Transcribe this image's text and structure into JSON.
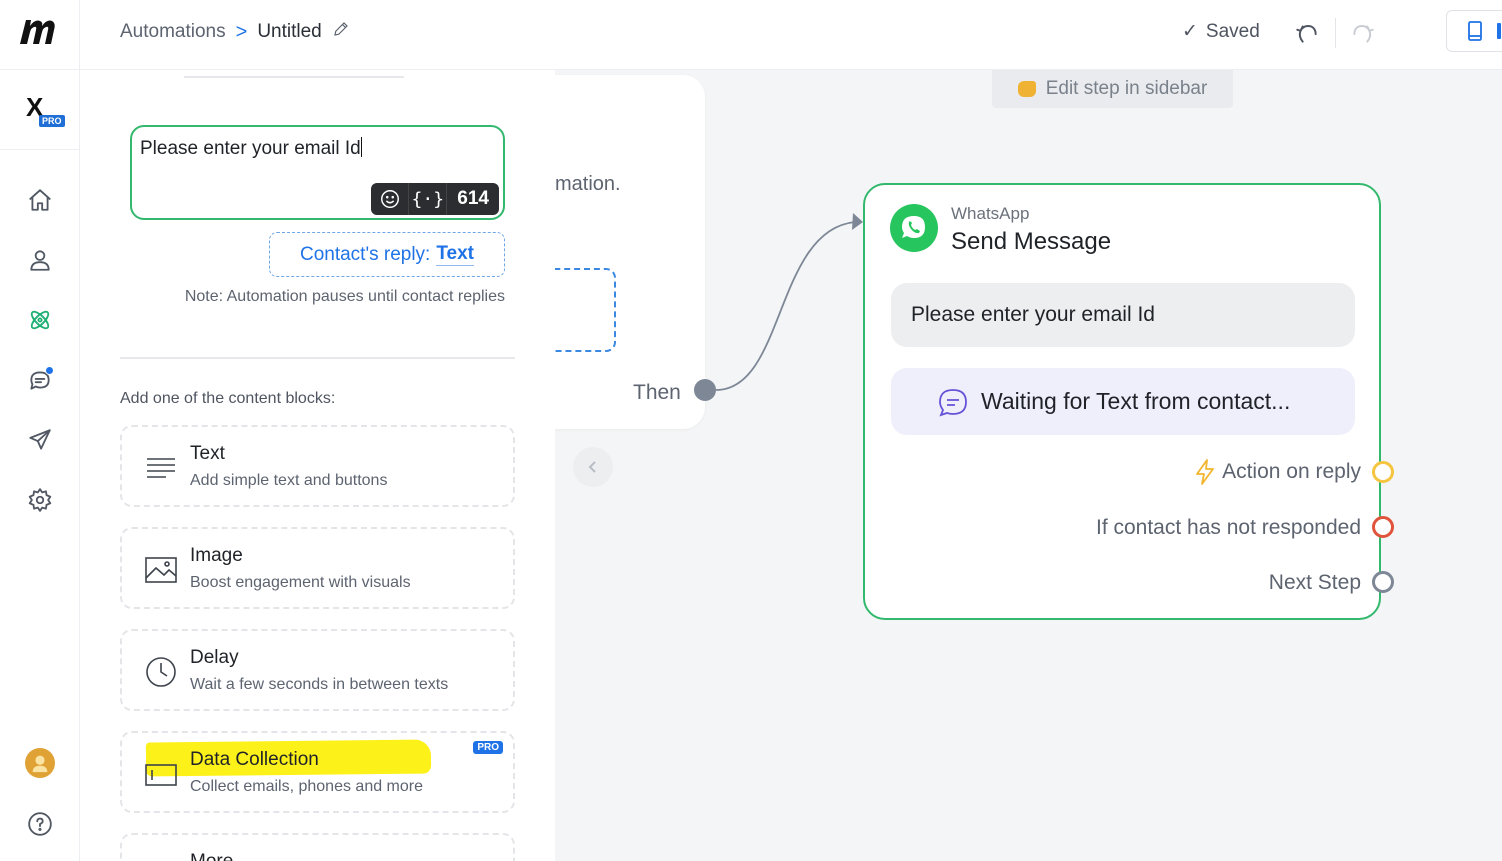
{
  "topbar": {
    "breadcrumb_root": "Automations",
    "breadcrumb_sep": ">",
    "title": "Untitled",
    "saved_check": "✓",
    "saved_label": "Saved"
  },
  "brand": {
    "badge": "PRO",
    "mark": "X"
  },
  "sidebar_nav": [
    "home-icon",
    "contacts-icon",
    "automations-icon",
    "chat-icon",
    "send-icon",
    "settings-icon",
    "help-icon"
  ],
  "editor": {
    "message_text": "Please enter your email Id",
    "tools": {
      "brace": "{·}",
      "counter": "614"
    },
    "reply_prefix": "Contact's reply:",
    "reply_type": "Text",
    "note": "Note: Automation pauses until contact replies",
    "blocks_title": "Add one of the content blocks:",
    "blocks": [
      {
        "title": "Text",
        "subtitle": "Add simple text and buttons",
        "icon": "text-lines-icon"
      },
      {
        "title": "Image",
        "subtitle": "Boost engagement with visuals",
        "icon": "image-icon"
      },
      {
        "title": "Delay",
        "subtitle": "Wait a few seconds in between texts",
        "icon": "clock-icon"
      },
      {
        "title": "Data Collection",
        "subtitle": "Collect emails, phones and more",
        "badge": "PRO",
        "icon": "input-field-icon"
      },
      {
        "title": "More",
        "subtitle": ""
      }
    ]
  },
  "canvas": {
    "hint": "Edit step in sidebar",
    "left_card_fragment": "mation.",
    "then_label": "Then",
    "node": {
      "kicker": "WhatsApp",
      "title": "Send Message",
      "message": "Please enter your email Id",
      "waiting": "Waiting for Text from contact...",
      "routes": {
        "action_on_reply": "Action on reply",
        "not_responded": "If contact has not responded",
        "next_step": "Next Step"
      }
    }
  },
  "colors": {
    "accent_green": "#33b96d",
    "link_blue": "#1f73e6",
    "port_yellow": "#f5c542",
    "port_red": "#e0543c",
    "port_grey": "#7d8796",
    "highlight": "#fdf11a"
  }
}
